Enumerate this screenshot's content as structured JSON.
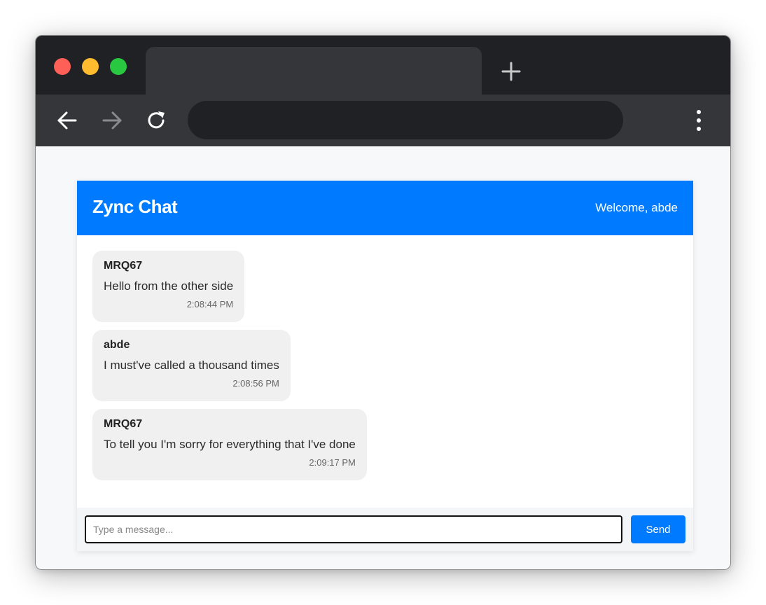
{
  "browser": {
    "colors": {
      "close": "#fe5f57",
      "minimize": "#febc2e",
      "maximize": "#28c840",
      "frame": "#202124",
      "toolbar": "#35363a"
    },
    "icons": {
      "back": "arrow-left-icon",
      "forward": "arrow-right-icon",
      "reload": "reload-icon",
      "new_tab": "plus-icon",
      "menu": "kebab-menu-icon"
    }
  },
  "chat": {
    "title": "Zync Chat",
    "welcome": "Welcome, abde",
    "accent_color": "#007bff",
    "messages": [
      {
        "user": "MRQ67",
        "text": "Hello from the other side",
        "time": "2:08:44 PM"
      },
      {
        "user": "abde",
        "text": "I must've called a thousand times",
        "time": "2:08:56 PM"
      },
      {
        "user": "MRQ67",
        "text": "To tell you I'm sorry for everything that I've done",
        "time": "2:09:17 PM"
      }
    ],
    "input": {
      "placeholder": "Type a message...",
      "value": ""
    },
    "send_label": "Send"
  }
}
